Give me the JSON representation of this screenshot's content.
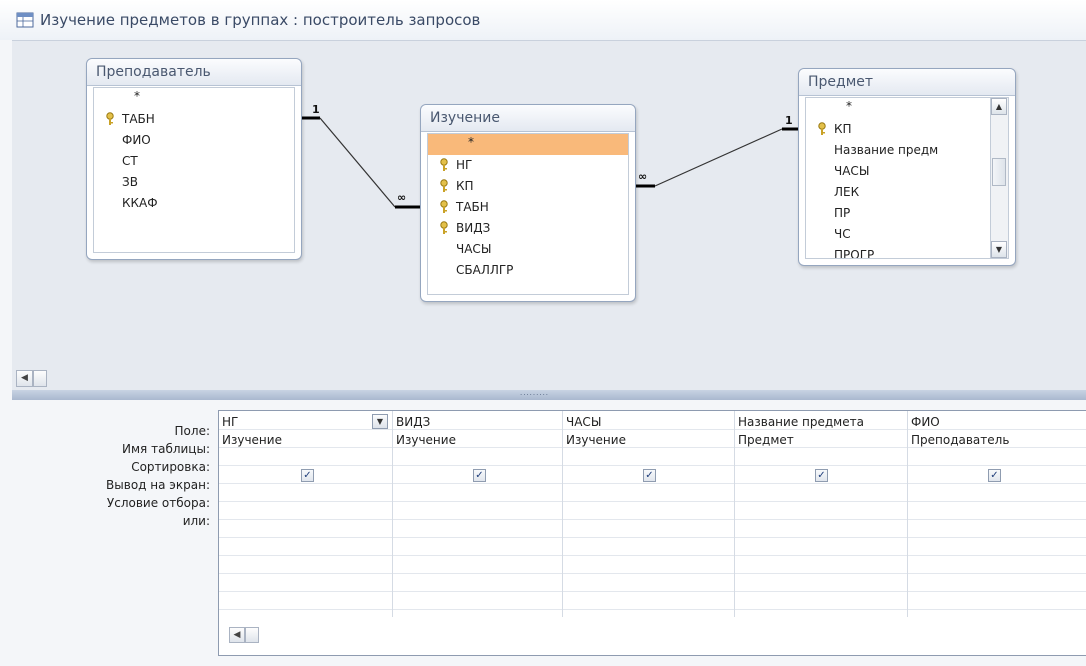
{
  "window": {
    "title": "Изучение предметов в группах : построитель запросов"
  },
  "tables": [
    {
      "name": "Преподаватель",
      "fields": [
        {
          "name": "*",
          "key": false
        },
        {
          "name": "ТАБН",
          "key": true
        },
        {
          "name": "ФИО",
          "key": false
        },
        {
          "name": "СТ",
          "key": false
        },
        {
          "name": "ЗВ",
          "key": false
        },
        {
          "name": "ККАФ",
          "key": false
        }
      ]
    },
    {
      "name": "Изучение",
      "fields": [
        {
          "name": "*",
          "key": false,
          "selected": true
        },
        {
          "name": "НГ",
          "key": true
        },
        {
          "name": "КП",
          "key": true
        },
        {
          "name": "ТАБН",
          "key": true
        },
        {
          "name": "ВИДЗ",
          "key": true
        },
        {
          "name": "ЧАСЫ",
          "key": false
        },
        {
          "name": "СБАЛЛГР",
          "key": false
        }
      ]
    },
    {
      "name": "Предмет",
      "fields": [
        {
          "name": "*",
          "key": false
        },
        {
          "name": "КП",
          "key": true
        },
        {
          "name": "Название предм",
          "key": false
        },
        {
          "name": "ЧАСЫ",
          "key": false
        },
        {
          "name": "ЛЕК",
          "key": false
        },
        {
          "name": "ПР",
          "key": false
        },
        {
          "name": "ЧС",
          "key": false
        },
        {
          "name": "ПРОГР",
          "key": false
        }
      ]
    }
  ],
  "relationships": [
    {
      "from": "Преподаватель.ТАБН",
      "to": "Изучение.ТАБН",
      "one_label": "1",
      "many_label": "∞"
    },
    {
      "from": "Предмет.КП",
      "to": "Изучение.КП",
      "one_label": "1",
      "many_label": "∞"
    }
  ],
  "grid": {
    "row_labels": [
      "Поле:",
      "Имя таблицы:",
      "Сортировка:",
      "Вывод на экран:",
      "Условие отбора:",
      "или:"
    ],
    "columns": [
      {
        "field": "НГ",
        "table": "Изучение",
        "sort": "",
        "show": true,
        "has_dropdown": true
      },
      {
        "field": "ВИДЗ",
        "table": "Изучение",
        "sort": "",
        "show": true,
        "has_dropdown": false
      },
      {
        "field": "ЧАСЫ",
        "table": "Изучение",
        "sort": "",
        "show": true,
        "has_dropdown": false
      },
      {
        "field": "Название предмета",
        "table": "Предмет",
        "sort": "",
        "show": true,
        "has_dropdown": false
      },
      {
        "field": "ФИО",
        "table": "Преподаватель",
        "sort": "",
        "show": true,
        "has_dropdown": false
      }
    ]
  },
  "icons": {
    "key": "key-icon",
    "check": "checkmark-icon",
    "scroll_left": "scroll-left-icon",
    "dropdown": "chevron-down-icon"
  },
  "colors": {
    "selected_field": "#f9b97a",
    "key_gold": "#c9a227",
    "title_text": "#3a4a66"
  }
}
